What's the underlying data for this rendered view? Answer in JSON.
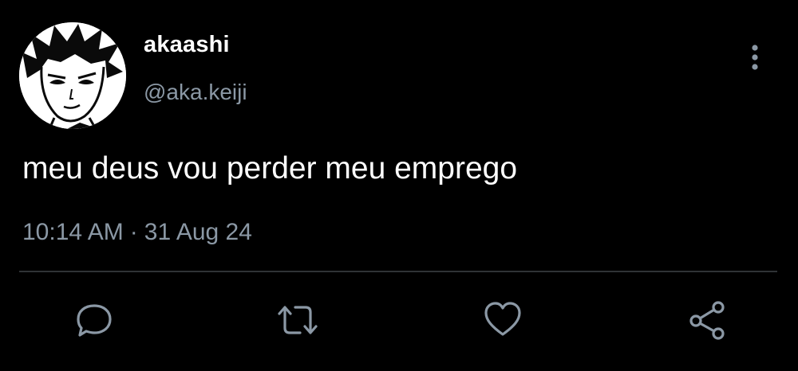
{
  "user": {
    "display_name": "akaashi",
    "handle": "@aka.keiji"
  },
  "tweet": {
    "text": "meu deus vou perder meu emprego",
    "time": "10:14 AM",
    "separator": "·",
    "date": "31 Aug 24"
  },
  "actions": [
    {
      "icon": "reply-icon"
    },
    {
      "icon": "retweet-icon"
    },
    {
      "icon": "like-icon"
    },
    {
      "icon": "share-icon"
    }
  ],
  "colors": {
    "background": "#000000",
    "text": "#ffffff",
    "secondary": "#8b98a5",
    "divider": "#2f3336"
  }
}
